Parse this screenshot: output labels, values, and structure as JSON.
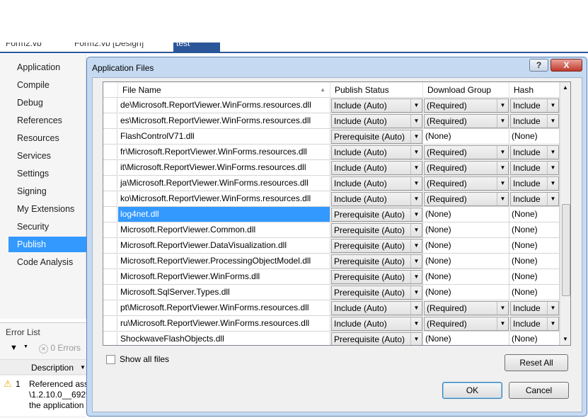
{
  "tabs": [
    "Form2.vb",
    "Form2.vb [Design]",
    "test"
  ],
  "nav": {
    "items": [
      "Application",
      "Compile",
      "Debug",
      "References",
      "Resources",
      "Services",
      "Settings",
      "Signing",
      "My Extensions",
      "Security",
      "Publish",
      "Code Analysis"
    ],
    "active": "Publish"
  },
  "error_list": {
    "title": "Error List",
    "errors_label": "0 Errors",
    "header": "Description",
    "row_num": "1",
    "row_text": [
      "Referenced asse",
      "\\1.2.10.0__692fb",
      "the application"
    ]
  },
  "dialog": {
    "title": "Application Files",
    "help_btn": "?",
    "close_btn": "X",
    "columns": [
      "File Name",
      "Publish Status",
      "Download Group",
      "Hash"
    ],
    "rows": [
      {
        "file": "de\\Microsoft.ReportViewer.WinForms.resources.dll",
        "status": "Include (Auto)",
        "group": "(Required)",
        "hash": "Include",
        "combo": true
      },
      {
        "file": "es\\Microsoft.ReportViewer.WinForms.resources.dll",
        "status": "Include (Auto)",
        "group": "(Required)",
        "hash": "Include",
        "combo": true
      },
      {
        "file": "FlashControlV71.dll",
        "status": "Prerequisite (Auto)",
        "group": "(None)",
        "hash": "(None)",
        "combo": false
      },
      {
        "file": "fr\\Microsoft.ReportViewer.WinForms.resources.dll",
        "status": "Include (Auto)",
        "group": "(Required)",
        "hash": "Include",
        "combo": true
      },
      {
        "file": "it\\Microsoft.ReportViewer.WinForms.resources.dll",
        "status": "Include (Auto)",
        "group": "(Required)",
        "hash": "Include",
        "combo": true
      },
      {
        "file": "ja\\Microsoft.ReportViewer.WinForms.resources.dll",
        "status": "Include (Auto)",
        "group": "(Required)",
        "hash": "Include",
        "combo": true
      },
      {
        "file": "ko\\Microsoft.ReportViewer.WinForms.resources.dll",
        "status": "Include (Auto)",
        "group": "(Required)",
        "hash": "Include",
        "combo": true
      },
      {
        "file": "log4net.dll",
        "status": "Prerequisite (Auto)",
        "group": "(None)",
        "hash": "(None)",
        "combo": false,
        "selected": true
      },
      {
        "file": "Microsoft.ReportViewer.Common.dll",
        "status": "Prerequisite (Auto)",
        "group": "(None)",
        "hash": "(None)",
        "combo": false
      },
      {
        "file": "Microsoft.ReportViewer.DataVisualization.dll",
        "status": "Prerequisite (Auto)",
        "group": "(None)",
        "hash": "(None)",
        "combo": false
      },
      {
        "file": "Microsoft.ReportViewer.ProcessingObjectModel.dll",
        "status": "Prerequisite (Auto)",
        "group": "(None)",
        "hash": "(None)",
        "combo": false
      },
      {
        "file": "Microsoft.ReportViewer.WinForms.dll",
        "status": "Prerequisite (Auto)",
        "group": "(None)",
        "hash": "(None)",
        "combo": false
      },
      {
        "file": "Microsoft.SqlServer.Types.dll",
        "status": "Prerequisite (Auto)",
        "group": "(None)",
        "hash": "(None)",
        "combo": false
      },
      {
        "file": "pt\\Microsoft.ReportViewer.WinForms.resources.dll",
        "status": "Include (Auto)",
        "group": "(Required)",
        "hash": "Include",
        "combo": true
      },
      {
        "file": "ru\\Microsoft.ReportViewer.WinForms.resources.dll",
        "status": "Include (Auto)",
        "group": "(Required)",
        "hash": "Include",
        "combo": true
      },
      {
        "file": "ShockwaveFlashObjects.dll",
        "status": "Prerequisite (Auto)",
        "group": "(None)",
        "hash": "(None)",
        "combo": false
      }
    ],
    "show_all_label": "Show all files",
    "reset_label": "Reset All",
    "ok_label": "OK",
    "cancel_label": "Cancel"
  }
}
